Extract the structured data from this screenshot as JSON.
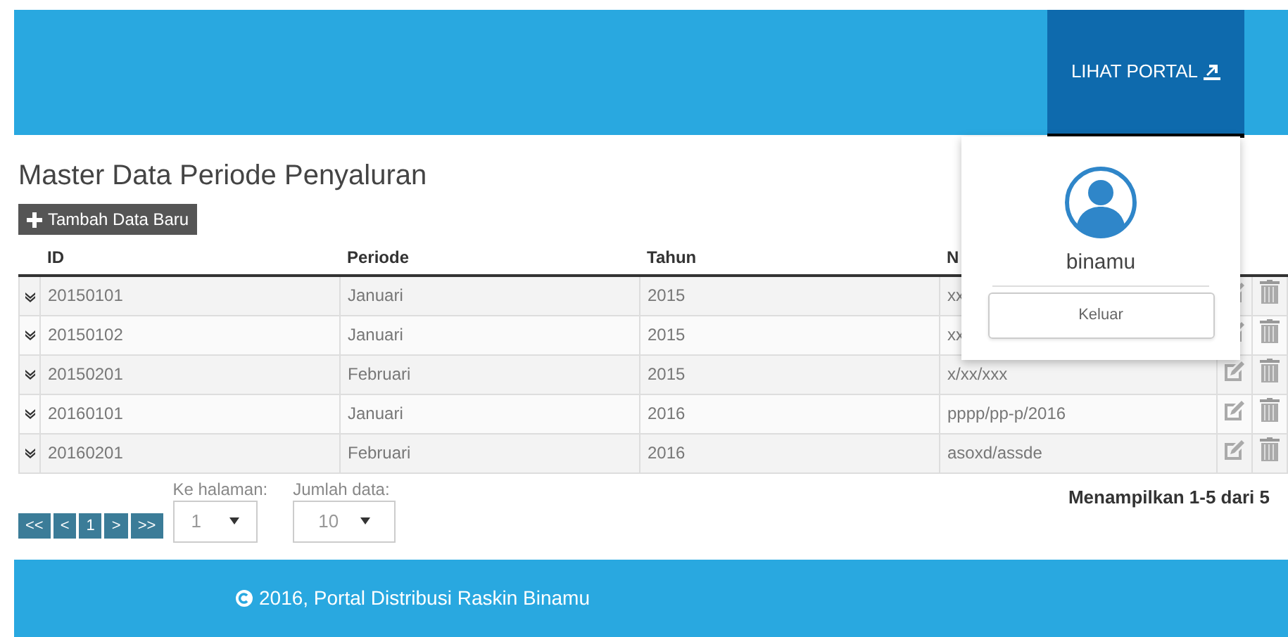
{
  "header": {
    "portal_button": "LIHAT PORTAL"
  },
  "page_title": "Master Data Periode Penyaluran",
  "add_button": "Tambah Data Baru",
  "table": {
    "columns": [
      "ID",
      "Periode",
      "Tahun",
      "N"
    ],
    "rows": [
      {
        "id": "20150101",
        "periode": "Januari",
        "tahun": "2015",
        "column_4": "xx"
      },
      {
        "id": "20150102",
        "periode": "Januari",
        "tahun": "2015",
        "column_4": "xx"
      },
      {
        "id": "20150201",
        "periode": "Februari",
        "tahun": "2015",
        "column_4": "x/xx/xxx"
      },
      {
        "id": "20160101",
        "periode": "Januari",
        "tahun": "2016",
        "column_4": "pppp/pp-p/2016"
      },
      {
        "id": "20160201",
        "periode": "Februari",
        "tahun": "2016",
        "column_4": "asoxd/assde"
      }
    ]
  },
  "pagination": {
    "buttons": [
      "<<",
      "<",
      "1",
      ">",
      ">>"
    ],
    "page_label": "Ke halaman:",
    "page_value": "1",
    "size_label": "Jumlah data:",
    "size_value": "10",
    "summary": "Menampilkan 1-5 dari 5"
  },
  "user_menu": {
    "username": "binamu",
    "logout_button": "Keluar"
  },
  "footer": {
    "copyright": "2016, Portal Distribusi Raskin Binamu"
  }
}
